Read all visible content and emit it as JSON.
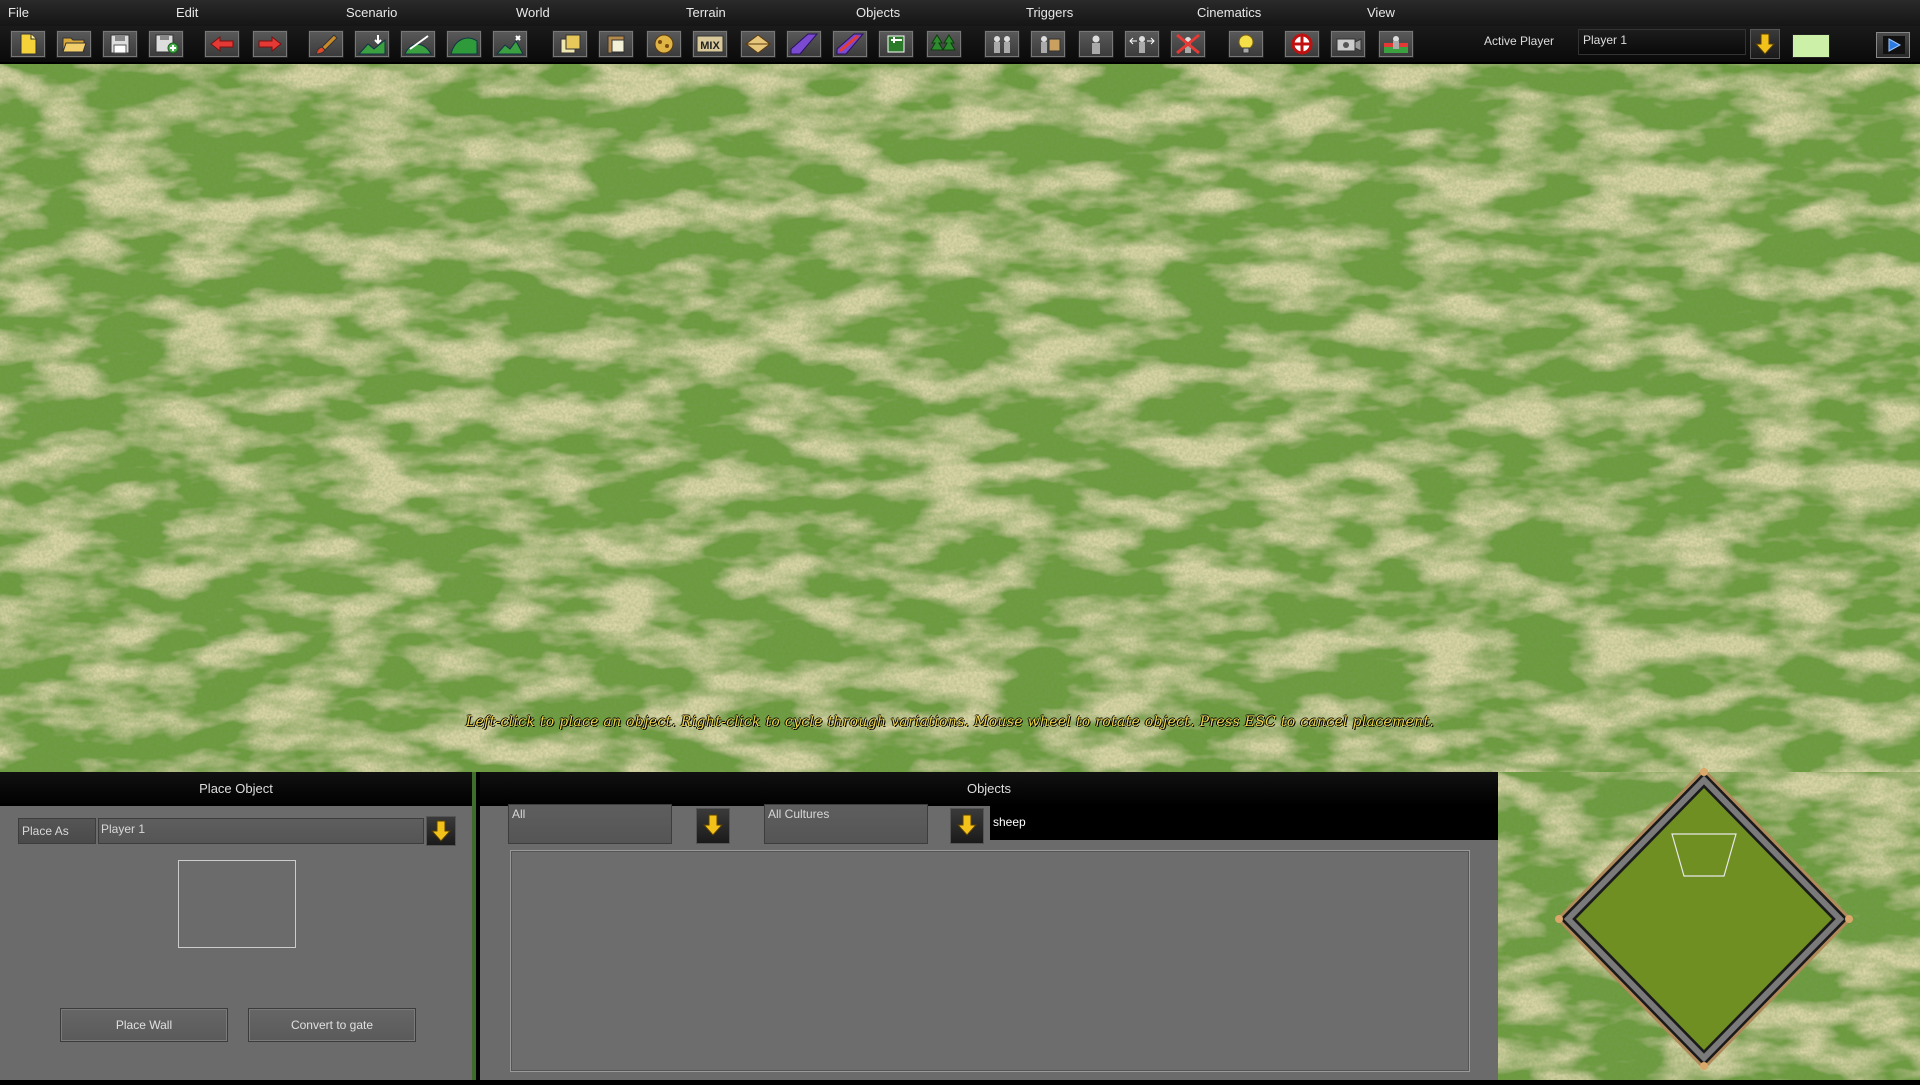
{
  "menu": {
    "items": [
      "File",
      "Edit",
      "Scenario",
      "World",
      "Terrain",
      "Objects",
      "Triggers",
      "Cinematics",
      "View"
    ]
  },
  "toolbar": {
    "tools": [
      {
        "name": "new-file-icon"
      },
      {
        "name": "open-folder-icon"
      },
      {
        "name": "save-icon"
      },
      {
        "name": "save-as-icon"
      },
      {
        "name": "undo-arrow-icon"
      },
      {
        "name": "redo-arrow-icon"
      },
      {
        "name": "paint-brush-icon"
      },
      {
        "name": "raise-terrain-icon"
      },
      {
        "name": "smooth-terrain-icon"
      },
      {
        "name": "terrain-height-icon"
      },
      {
        "name": "terrain-elevation-icon"
      },
      {
        "name": "copy-icon"
      },
      {
        "name": "paste-icon"
      },
      {
        "name": "texture-icon"
      },
      {
        "name": "mix-icon",
        "label": "MIX"
      },
      {
        "name": "blend-terrain-icon"
      },
      {
        "name": "water-icon"
      },
      {
        "name": "cliff-icon"
      },
      {
        "name": "area-icon"
      },
      {
        "name": "forest-icon"
      },
      {
        "name": "units-icon"
      },
      {
        "name": "place-units-icon"
      },
      {
        "name": "single-unit-icon"
      },
      {
        "name": "move-unit-icon"
      },
      {
        "name": "delete-unit-icon"
      },
      {
        "name": "light-bulb-icon"
      },
      {
        "name": "target-icon"
      },
      {
        "name": "camera-icon"
      },
      {
        "name": "player-flag-icon"
      }
    ],
    "active_player_label": "Active Player",
    "active_player_value": "Player 1",
    "player_color": "#ccf0a8"
  },
  "map": {
    "hint": "Left-click to place an object. Right-click to cycle through variations. Mouse wheel to rotate object. Press ESC to cancel placement."
  },
  "place_panel": {
    "title": "Place Object",
    "place_as_label": "Place As",
    "place_as_value": "Player 1",
    "place_wall_label": "Place Wall",
    "convert_gate_label": "Convert to gate"
  },
  "objects_panel": {
    "title": "Objects",
    "filter_category": "All",
    "filter_culture": "All Cultures",
    "search_value": "sheep"
  },
  "colors": {
    "grass": "#6a9a3a",
    "minimap_fill": "#6f8f22",
    "hint_text": "#f0d24a",
    "panel_bg": "#6b6b6b"
  }
}
